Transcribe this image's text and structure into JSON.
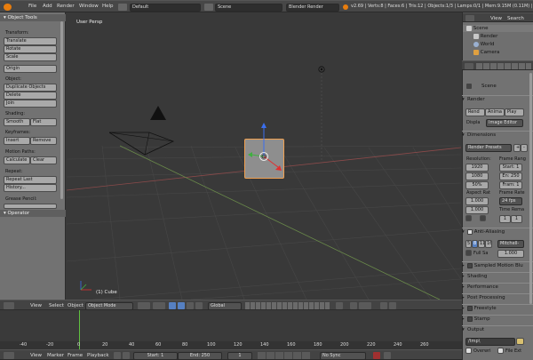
{
  "topbar": {
    "menus": [
      "File",
      "Add",
      "Render",
      "Window",
      "Help"
    ],
    "layout": "Default",
    "scene": "Scene",
    "engine": "Blender Render",
    "stats": "v2.69 | Verts:8 | Faces:6 | Tris:12 | Objects:1/3 | Lamps:0/1 | Mem:9.15M (0.11M) | Cube"
  },
  "tools": {
    "title": "Object Tools",
    "transform_label": "Transform:",
    "translate": "Translate",
    "rotate": "Rotate",
    "scale": "Scale",
    "origin": "Origin",
    "object_label": "Object:",
    "duplicate": "Duplicate Objects",
    "delete": "Delete",
    "join": "Join",
    "shading_label": "Shading:",
    "smooth": "Smooth",
    "flat": "Flat",
    "keyframes_label": "Keyframes:",
    "insert": "Insert",
    "remove": "Remove",
    "motion_label": "Motion Paths:",
    "calculate": "Calculate",
    "clear": "Clear",
    "repeat_label": "Repeat:",
    "repeat_last": "Repeat Last",
    "history": "History...",
    "grease_label": "Grease Pencil:",
    "operator": "Operator"
  },
  "viewport": {
    "view_name": "User Persp",
    "object_name": "(1) Cube",
    "header": {
      "view": "View",
      "select": "Select",
      "object": "Object",
      "mode": "Object Mode",
      "pivot": "Global"
    }
  },
  "timeline": {
    "ticks": [
      "-40",
      "-20",
      "0",
      "20",
      "40",
      "60",
      "80",
      "100",
      "120",
      "140",
      "160",
      "180",
      "200",
      "220",
      "240",
      "260"
    ],
    "header": {
      "view": "View",
      "marker": "Marker",
      "frame": "Frame",
      "playback": "Playback",
      "start": "Start: 1",
      "end": "End: 250",
      "current": "1",
      "sync": "No Sync"
    }
  },
  "outliner": {
    "view": "View",
    "search": "Search",
    "items": [
      "Scene",
      "Render",
      "World",
      "Camera"
    ]
  },
  "properties": {
    "context": "Scene",
    "render_section": "Render",
    "render_btn": "Rend",
    "anim_btn": "Anima",
    "play_btn": "Play",
    "display_label": "Displa",
    "display_value": "Image Editor",
    "dimensions": "Dimensions",
    "presets": "Render Presets",
    "resolution_label": "Resolution:",
    "frame_range_label": "Frame Rang",
    "res_x": "1920",
    "res_y": "1080",
    "res_pct": "50%",
    "start": "Start: 1",
    "end": "En: 250",
    "step": "Fram: 1",
    "aspect_label": "Aspect Rat",
    "frame_rate_label": "Frame Rate",
    "aspect_x": "1.000",
    "aspect_y": "1.000",
    "fps": "24 fps",
    "time_remap": "Time Rema",
    "remap_old": "1",
    "remap_new": "1",
    "aa_label": "Anti-Aliasing",
    "aa_samples": [
      "5",
      "8",
      "11",
      "16"
    ],
    "aa_filter": "Mitchell-",
    "full_sample": "Full Sa",
    "aa_size": "1.000",
    "sampled_motion": "Sampled Motion Blu",
    "shading": "Shading",
    "performance": "Performance",
    "post_processing": "Post Processing",
    "freestyle": "Freestyle",
    "stamp": "Stamp",
    "output": "Output",
    "output_path": "/tmp\\",
    "overwrite": "Overwri",
    "file_ext": "File Ext"
  },
  "colors": {
    "viewport_bg": "#393939",
    "accent": "#5680c2",
    "selection": "#f0a050"
  }
}
